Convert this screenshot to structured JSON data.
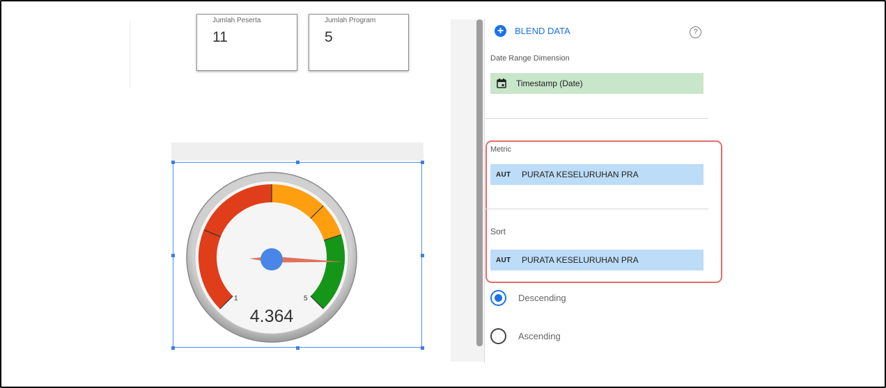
{
  "scorecards": [
    {
      "label": "Jumlah Peserta",
      "value": "11"
    },
    {
      "label": "Jumlah Program",
      "value": "5"
    }
  ],
  "gauge": {
    "value": "4.364",
    "value_number": 4.364,
    "min_label": "1",
    "max_label": "5",
    "min": 1,
    "max": 5,
    "band_colors": [
      "#e03e1a",
      "#ff9e0f",
      "#159619"
    ]
  },
  "panel": {
    "blend_label": "BLEND DATA",
    "help_icon": "help-circle-icon",
    "date_range_label": "Date Range Dimension",
    "date_dimension": "Timestamp (Date)",
    "date_icon": "calendar-icon",
    "metric_label": "Metric",
    "metric_type": "AUT",
    "metric_name": "PURATA KESELURUHAN PRA",
    "sort_label": "Sort",
    "sort_type": "AUT",
    "sort_name": "PURATA KESELURUHAN PRA",
    "order_options": [
      "Descending",
      "Ascending"
    ],
    "order_selected": "Descending"
  },
  "colors": {
    "accent": "#1a73e8",
    "date_chip": "#c8e6c9",
    "metric_chip": "#bcdcf7",
    "highlight": "#e46a6a"
  }
}
